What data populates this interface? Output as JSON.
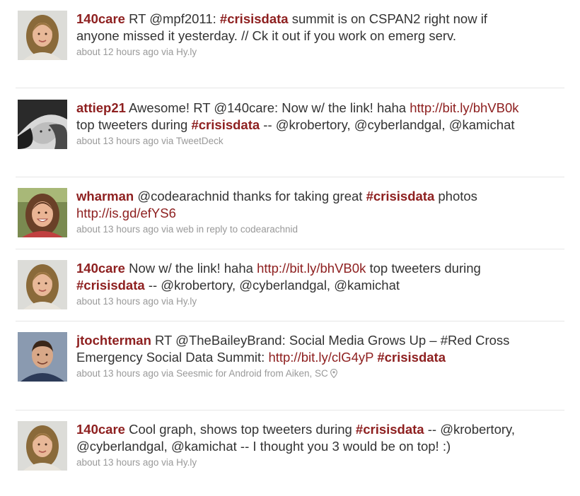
{
  "tweets": [
    {
      "avatar": "woman-longhair-avatar",
      "author": "140care",
      "segments": [
        {
          "t": " RT @mpf2011: "
        },
        {
          "t": "#crisisdata",
          "k": "hash"
        },
        {
          "t": " summit is on CSPAN2 right now if anyone missed it yesterday. // Ck it out if you work on emerg serv."
        }
      ],
      "time": "about 12 hours ago",
      "via": " via ",
      "source": "Hy.ly"
    },
    {
      "avatar": "bw-portrait-avatar",
      "author": "attiep21",
      "segments": [
        {
          "t": " Awesome! RT @140care: Now w/ the link! haha "
        },
        {
          "t": "http://bit.ly/bhVB0k",
          "k": "link"
        },
        {
          "t": " top tweeters during "
        },
        {
          "t": "#crisisdata",
          "k": "hash"
        },
        {
          "t": " -- @krobertory, @cyberlandgal, @kamichat"
        }
      ],
      "time": "about 13 hours ago",
      "via": " via ",
      "source": "TweetDeck"
    },
    {
      "avatar": "woman-smiling-avatar",
      "author": "wharman",
      "segments": [
        {
          "t": " @codearachnid thanks for taking great "
        },
        {
          "t": "#crisisdata",
          "k": "hash"
        },
        {
          "t": " photos "
        },
        {
          "t": "http://is.gd/efYS6",
          "k": "link"
        }
      ],
      "time": "about 13 hours ago",
      "via": " via ",
      "source": "web",
      "reply": " in reply to codearachnid"
    },
    {
      "avatar": "woman-longhair-avatar",
      "author": "140care",
      "segments": [
        {
          "t": " Now w/ the link! haha "
        },
        {
          "t": "http://bit.ly/bhVB0k",
          "k": "link"
        },
        {
          "t": " top tweeters during "
        },
        {
          "t": "#crisisdata",
          "k": "hash"
        },
        {
          "t": " -- @krobertory, @cyberlandgal, @kamichat"
        }
      ],
      "time": "about 13 hours ago",
      "via": " via ",
      "source": "Hy.ly"
    },
    {
      "avatar": "man-portrait-avatar",
      "author": "jtochterman",
      "segments": [
        {
          "t": " RT @TheBaileyBrand: Social Media Grows Up – #Red Cross Emergency Social Data Summit: "
        },
        {
          "t": "http://bit.ly/clG4yP",
          "k": "link"
        },
        {
          "t": " "
        },
        {
          "t": "#crisisdata",
          "k": "hash"
        }
      ],
      "time": "about 13 hours ago",
      "via": " via ",
      "source": "Seesmic for Android",
      "location": " from Aiken, SC"
    },
    {
      "avatar": "woman-longhair-avatar",
      "author": "140care",
      "segments": [
        {
          "t": " Cool graph, shows top tweeters during "
        },
        {
          "t": "#crisisdata",
          "k": "hash"
        },
        {
          "t": " -- @krobertory, @cyberlandgal, @kamichat -- I thought you 3 would be on top! :)"
        }
      ],
      "time": "about 13 hours ago",
      "via": " via ",
      "source": "Hy.ly"
    }
  ]
}
